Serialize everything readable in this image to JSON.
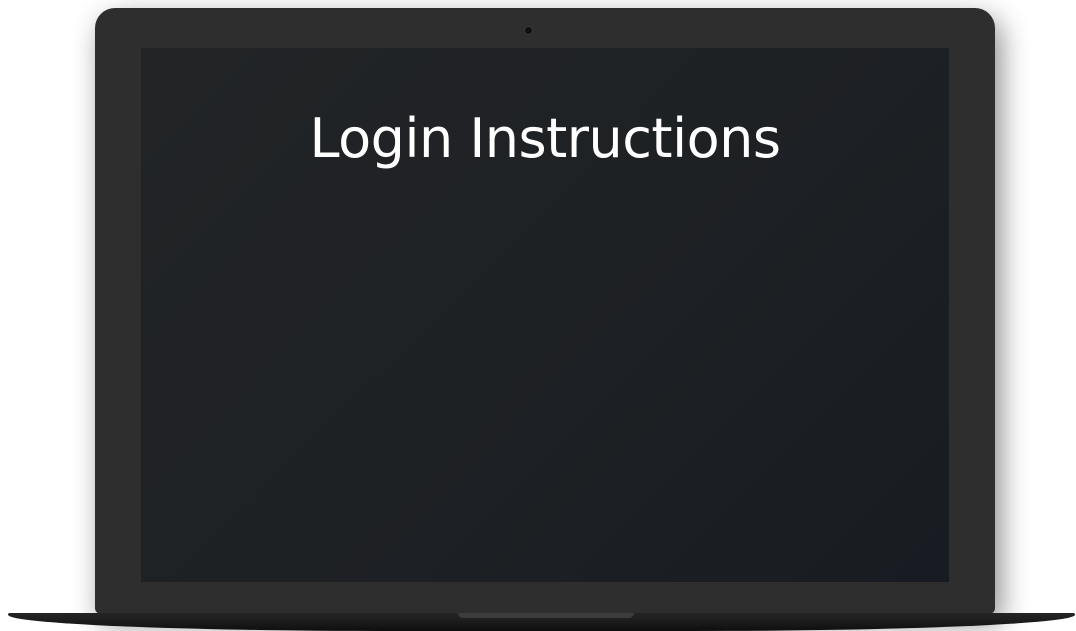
{
  "screen": {
    "title": "Login Instructions"
  },
  "colors": {
    "frame": "#2e2e2f",
    "screen_bg": "#1e2124",
    "title_text": "#ffffff",
    "base": "#1a1a1b"
  }
}
